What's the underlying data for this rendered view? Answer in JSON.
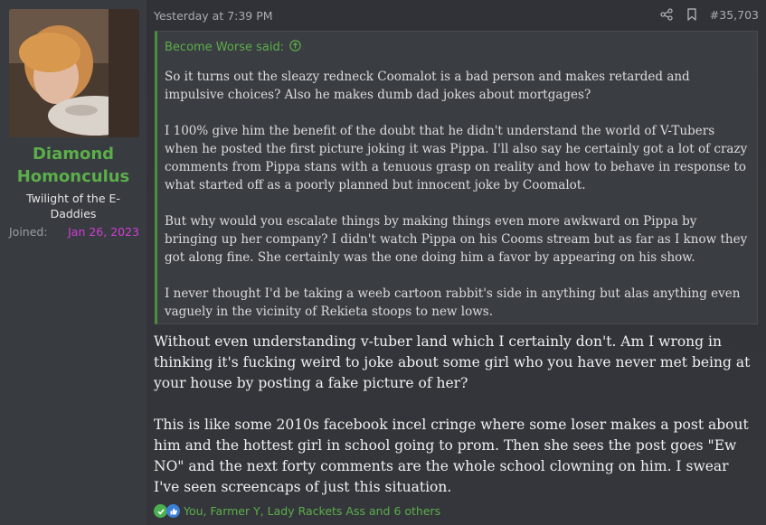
{
  "user": {
    "name_line1": "Diamond",
    "name_line2": "Homonculus",
    "title_line1": "Twilight of the E-",
    "title_line2": "Daddies",
    "joined_label": "Joined:",
    "joined_value": "Jan 26, 2023",
    "name_color": "#5cae4a",
    "joined_color": "#d23fd6"
  },
  "post": {
    "timestamp": "Yesterday at 7:39 PM",
    "number": "#35,703",
    "actions": [
      "share-icon",
      "bookmark-icon"
    ],
    "quote": {
      "author_label": "Become Worse said:",
      "paragraphs": [
        "So it turns out the sleazy redneck Coomalot is a bad person and makes retarded and impulsive choices? Also he makes dumb dad jokes about mortgages?",
        "I 100% give him the benefit of the doubt that he didn't understand the world of V-Tubers when he posted the first picture joking it was Pippa. I'll also say he certainly got a lot of crazy comments from Pippa stans with a tenuous grasp on reality and how to behave in response to what started off as a poorly planned but innocent joke by Coomalot.",
        "But why would you escalate things by making things even more awkward on Pippa by bringing up her company? I didn't watch Pippa on his Cooms stream but as far as I know they got along fine. She certainly was the one doing him a favor by appearing on his show.",
        "I never thought I'd be taking a weeb cartoon rabbit's side in anything but alas anything even vaguely in the vicinity of Rekieta stoops to new lows."
      ]
    },
    "paragraphs": [
      "Without even understanding v-tuber land which I certainly don't. Am I wrong in thinking it's fucking weird to joke about some girl who you have never met being at your house by posting a fake picture of her?",
      "This is like some 2010s facebook incel cringe where some loser makes a post about him and the hottest girl in school going to prom. Then she sees the post goes \"Ew NO\" and the next forty comments are the whole school clowning on him. I swear I've seen screencaps of just this situation."
    ],
    "reactions": {
      "icons": [
        "check-reaction-icon",
        "like-reaction-icon"
      ],
      "text": "You, Farmer Y, Lady Rackets Ass and 6 others"
    }
  },
  "colors": {
    "accent_green": "#5cae4a",
    "quote_border": "#4e8d3f",
    "background": "#2e3035",
    "sidebar": "#383b40"
  }
}
